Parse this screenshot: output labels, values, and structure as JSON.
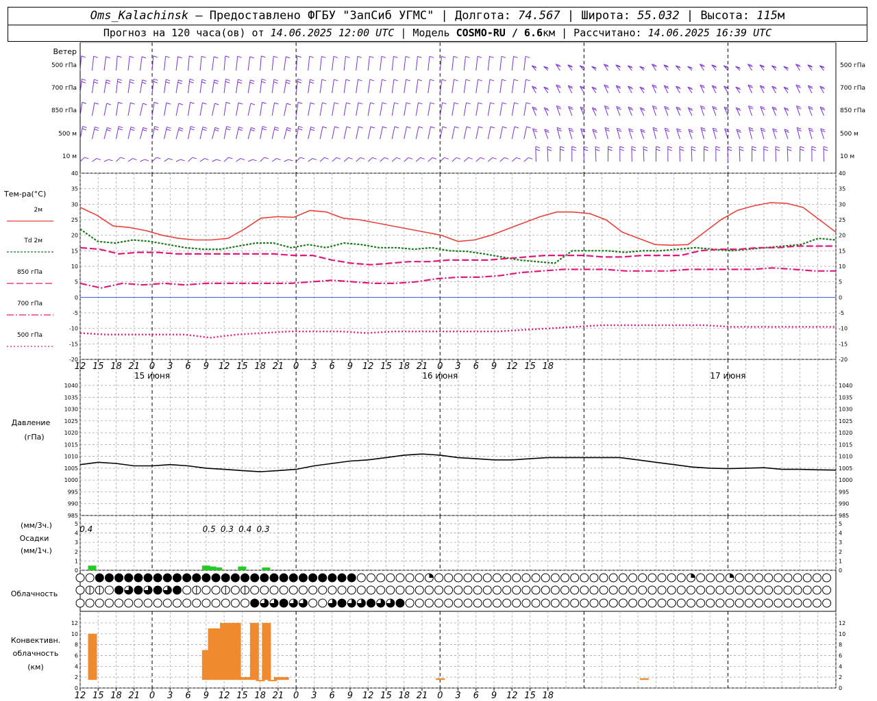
{
  "header": {
    "station": "Oms_Kalachinsk",
    "provider": "— Предоставлено ФГБУ \"ЗапСиб УГМС\" |",
    "lon_label": "Долгота:",
    "lon_value": "74.567",
    "lat_label": "| Широта:",
    "lat_value": "55.032",
    "alt_label": "| Высота:",
    "alt_value": "115",
    "alt_unit": "м",
    "forecast_label": "Прогноз на 120 часа(ов) от",
    "forecast_start": "14.06.2025 12:00 UTC",
    "model_label": "| Модель",
    "model_value": "COSMO-RU / 6.6",
    "model_unit": "км",
    "computed_label": "| Рассчитано:",
    "computed_value": "14.06.2025 16:39 UTC"
  },
  "panels": {
    "wind": {
      "title": "Ветер",
      "levels": [
        "500 гПа",
        "700 гПа",
        "850 гПа",
        "500 м",
        "10 м"
      ],
      "color": "#7b2fd6"
    },
    "temp": {
      "title": "Тем-ра(°С)",
      "legend": [
        {
          "label": "2м",
          "color": "#e8403a",
          "style": "solid"
        },
        {
          "label": "Td 2м",
          "color": "#1a7a1a",
          "style": "dotted"
        },
        {
          "label": "850 гПа",
          "color": "#e0187a",
          "style": "dashed"
        },
        {
          "label": "700 гПа",
          "color": "#e0187a",
          "style": "dashdot"
        },
        {
          "label": "500 гПа",
          "color": "#e0187a",
          "style": "dots"
        }
      ],
      "yticks": [
        "40",
        "35",
        "30",
        "25",
        "20",
        "15",
        "10",
        "5",
        "0",
        "-5",
        "-10",
        "-15",
        "-20"
      ]
    },
    "pressure": {
      "title": "Давление",
      "unit": "(гПа)",
      "yticks": [
        "1040",
        "1035",
        "1030",
        "1025",
        "1020",
        "1015",
        "1010",
        "1005",
        "1000",
        "995",
        "990",
        "985"
      ]
    },
    "precip": {
      "unit3": "(мм/3ч.)",
      "title": "Осадки",
      "unit1": "(мм/1ч.)",
      "yticks": [
        "5",
        "4",
        "3",
        "2",
        "1",
        "0"
      ],
      "labels": [
        "0.4",
        "0.5",
        "0.3",
        "0.4",
        "0.3"
      ],
      "color": "#22cc22"
    },
    "cloud": {
      "title": "Облачность"
    },
    "convective": {
      "title1": "Конвективн.",
      "title2": "облачность",
      "unit": "(км)",
      "yticks": [
        "12",
        "10",
        "8",
        "6",
        "4",
        "2",
        "0"
      ],
      "color": "#f08a2e"
    }
  },
  "time_axis": {
    "hours": [
      "12",
      "15",
      "18",
      "21",
      "0",
      "3",
      "6",
      "9",
      "12",
      "15",
      "18",
      "21",
      "0",
      "3",
      "6",
      "9",
      "12",
      "15",
      "18",
      "21",
      "0",
      "3",
      "6",
      "9",
      "12",
      "15",
      "18"
    ],
    "dates": [
      "15 июня",
      "16 июня",
      "17 июня"
    ]
  },
  "chart_data": [
    {
      "type": "line",
      "title": "Тем-ра(°С)",
      "x_hours_from_start": [
        0,
        2,
        4,
        6,
        9,
        12,
        15,
        18,
        21,
        24,
        27,
        30,
        33,
        36,
        39,
        42,
        45,
        48,
        51,
        54,
        57,
        60,
        63,
        66,
        69,
        72,
        75,
        78,
        81,
        84,
        87,
        90,
        93,
        96,
        99,
        102,
        105,
        108,
        111,
        114,
        117,
        120,
        123,
        126
      ],
      "ylim": [
        -20,
        40
      ],
      "series": [
        {
          "name": "2м",
          "values": [
            29,
            26.5,
            23,
            22.5,
            21.5,
            20,
            19,
            18.5,
            18.5,
            19,
            22,
            25.5,
            26,
            25.8,
            28,
            27.5,
            25.5,
            25,
            24,
            23,
            22,
            21,
            20,
            18,
            18.5,
            20,
            22,
            24,
            26,
            27.5,
            27.5,
            27,
            25,
            21,
            19,
            17,
            16.8,
            17,
            21,
            25,
            28,
            29.5,
            30.5,
            30.3,
            29,
            25,
            21
          ]
        },
        {
          "name": "Td 2м",
          "values": [
            22,
            18,
            17.5,
            18.5,
            18,
            17,
            16,
            15.5,
            15.5,
            16.5,
            17.5,
            17.5,
            16,
            17,
            16,
            17.5,
            17,
            16,
            16,
            15.5,
            16,
            15,
            14.8,
            14,
            13,
            12,
            11.5,
            11,
            15,
            15,
            15,
            14.5,
            15,
            15,
            15.5,
            16,
            15.5,
            15,
            15.5,
            16,
            16.5,
            17,
            19,
            18.5
          ]
        },
        {
          "name": "850 гПа",
          "values": [
            16,
            15.5,
            14,
            14.5,
            14.5,
            14,
            14,
            14,
            14,
            14,
            14,
            13.5,
            13.5,
            12,
            11,
            10.5,
            11,
            11.5,
            11.5,
            12,
            12,
            12,
            12.5,
            13,
            13.5,
            13.5,
            13.5,
            13,
            13,
            13.5,
            13.5,
            13.5,
            15,
            15.5,
            15.5,
            16,
            16,
            16.5,
            16.5,
            16.5
          ]
        },
        {
          "name": "700 гПа",
          "values": [
            4.5,
            3,
            4.5,
            4,
            4.5,
            4,
            4.5,
            4.5,
            4.5,
            4.5,
            4.5,
            5,
            5.5,
            5,
            4.5,
            4.5,
            5,
            6,
            6.5,
            6.5,
            7,
            8,
            8.5,
            9,
            9,
            9,
            8.5,
            8.5,
            8.5,
            9,
            9,
            9,
            9,
            9.5,
            9,
            8.5,
            8.5
          ]
        },
        {
          "name": "500 гПа",
          "values": [
            -11.5,
            -12,
            -12,
            -12,
            -12,
            -13,
            -12,
            -11.5,
            -11,
            -11,
            -11,
            -11.5,
            -11,
            -11,
            -11,
            -11,
            -11,
            -10.5,
            -10,
            -9.5,
            -9,
            -9,
            -9,
            -9,
            -9,
            -9.5,
            -9.5,
            -9.5,
            -9.5,
            -9.5
          ]
        }
      ]
    },
    {
      "type": "line",
      "title": "Давление",
      "ylabel": "(гПа)",
      "ylim": [
        985,
        1040
      ],
      "x_hours_from_start": [
        0,
        3,
        6,
        9,
        12,
        15,
        18,
        21,
        24,
        27,
        30,
        33,
        36,
        39,
        42,
        45,
        48,
        51,
        54,
        57,
        60,
        63,
        66,
        69,
        72,
        75,
        78,
        81,
        84,
        87,
        90,
        93,
        96,
        99,
        102,
        105,
        108,
        111,
        114,
        117,
        120,
        123,
        126
      ],
      "series": [
        {
          "name": "",
          "values": [
            1006.5,
            1007.5,
            1007,
            1006,
            1006,
            1006.5,
            1006,
            1005,
            1004.5,
            1004,
            1003.5,
            1004,
            1004.5,
            1006,
            1007,
            1008,
            1008.5,
            1009.5,
            1010.5,
            1011,
            1010.5,
            1009.5,
            1009,
            1008.5,
            1008.5,
            1009,
            1009.5,
            1009.5,
            1009.5,
            1009.5,
            1009.5,
            1008.5,
            1007.5,
            1006.5,
            1005.5,
            1005,
            1004.8,
            1005,
            1005.2,
            1004.5,
            1004.5,
            1004.3,
            1004.2
          ]
        }
      ]
    },
    {
      "type": "bar",
      "title": "Осадки",
      "ylabel": "(мм/1ч.)",
      "ylim": [
        0,
        5
      ],
      "x_hours_from_start": [
        2,
        21,
        22,
        23,
        27,
        31
      ],
      "values": [
        0.5,
        0.5,
        0.4,
        0.3,
        0.4,
        0.3
      ],
      "annotations": [
        {
          "x": 1,
          "text": "0.4"
        },
        {
          "x": 21.5,
          "text": "0.5"
        },
        {
          "x": 24.5,
          "text": "0.3"
        },
        {
          "x": 27.5,
          "text": "0.4"
        },
        {
          "x": 30.5,
          "text": "0.3"
        }
      ]
    },
    {
      "type": "bar",
      "title": "Конвективн. облачность",
      "ylabel": "(км)",
      "ylim": [
        0,
        12
      ],
      "x_hours_from_start": [
        2,
        21,
        22,
        23,
        24,
        25,
        26,
        27,
        28,
        29,
        30,
        31,
        32,
        33,
        34,
        60,
        94
      ],
      "base": [
        1.5,
        1.5,
        1.5,
        1.5,
        1.5,
        1.5,
        1.5,
        1.5,
        1.5,
        1.5,
        1.5,
        1.5,
        1.5,
        1.5,
        1.5,
        1.5,
        1.5
      ],
      "top": [
        10,
        7,
        11,
        11,
        12,
        12,
        12,
        2,
        2,
        12,
        1.5,
        12,
        1.5,
        2,
        2,
        1.8,
        1.8
      ]
    }
  ]
}
